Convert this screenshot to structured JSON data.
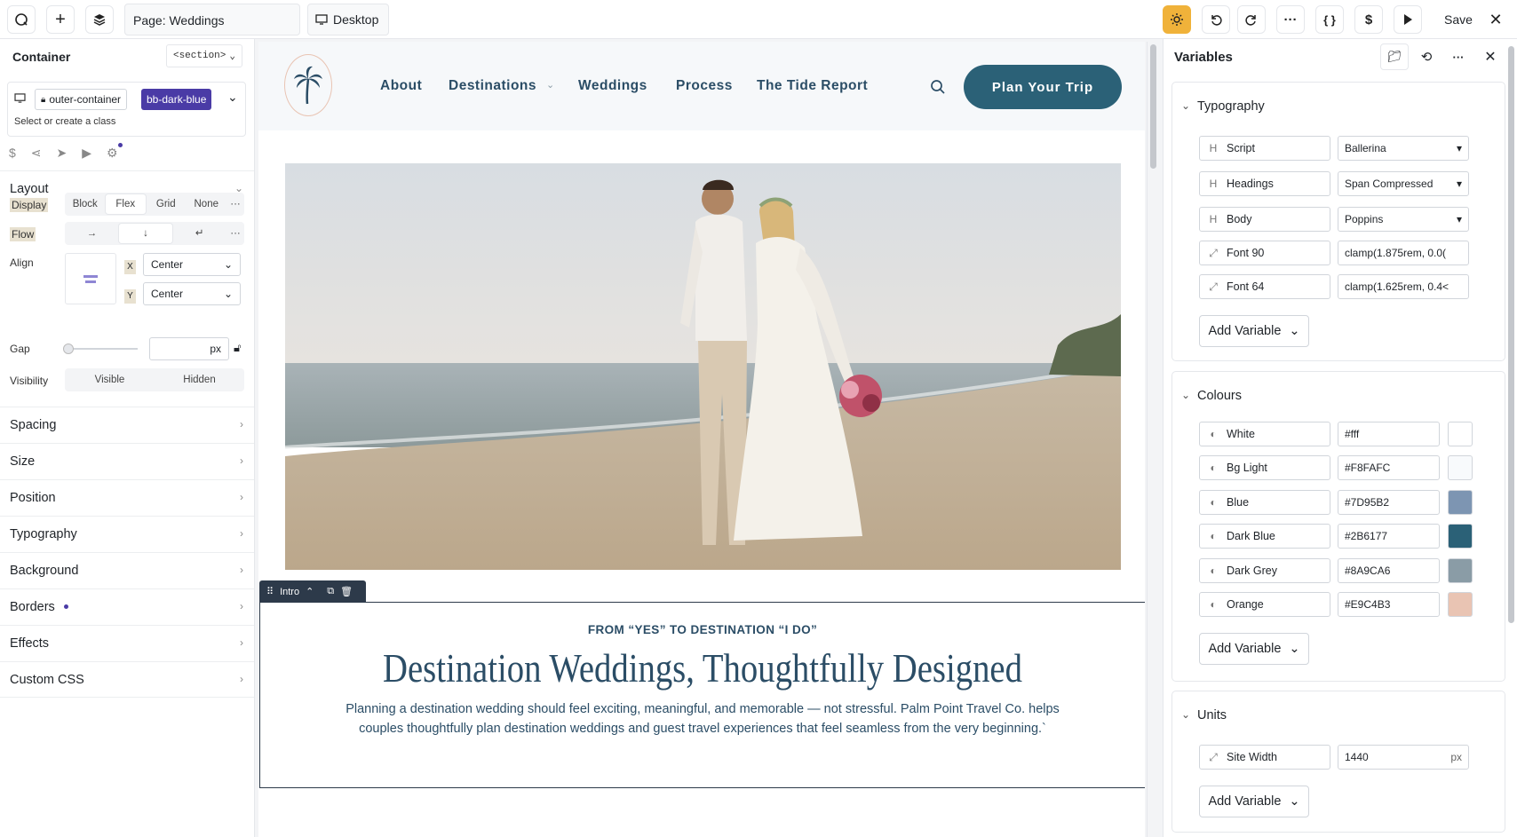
{
  "topbar": {
    "page_label": "Page: Weddings",
    "device_label": "Desktop",
    "save_label": "Save"
  },
  "left_panel": {
    "title": "Container",
    "tag": "<section>",
    "class_chip": "outer-container",
    "active_class": "bb-dark-blue",
    "class_hint": "Select or create a class",
    "layout": {
      "title": "Layout",
      "display_label": "Display",
      "display_options": [
        "Block",
        "Flex",
        "Grid",
        "None"
      ],
      "display_selected": "Flex",
      "flow_label": "Flow",
      "align_label": "Align",
      "x_label": "X",
      "x_value": "Center",
      "y_label": "Y",
      "y_value": "Center",
      "gap_label": "Gap",
      "gap_unit": "px",
      "visibility_label": "Visibility",
      "visibility_options": [
        "Visible",
        "Hidden"
      ]
    },
    "sections": [
      "Spacing",
      "Size",
      "Position",
      "Typography",
      "Background",
      "Borders",
      "Effects",
      "Custom CSS"
    ]
  },
  "canvas": {
    "nav_links": [
      "About",
      "Destinations",
      "Weddings",
      "Process",
      "The Tide Report"
    ],
    "cta_label": "Plan Your Trip",
    "intro_label": "Intro",
    "eyebrow": "FROM “YES” TO DESTINATION “I DO”",
    "headline": "Destination Weddings, Thoughtfully Designed",
    "body_line1": "Planning a destination wedding should feel exciting, meaningful, and memorable — not stressful. Palm Point Travel Co. helps",
    "body_line2": "couples thoughtfully plan destination weddings and guest travel experiences that feel seamless from the very beginning.`"
  },
  "right_panel": {
    "title": "Variables",
    "add_variable_label": "Add Variable",
    "typography": {
      "title": "Typography",
      "items": [
        {
          "name": "Script",
          "value": "Ballerina"
        },
        {
          "name": "Headings",
          "value": "Span Compressed"
        },
        {
          "name": "Body",
          "value": "Poppins"
        },
        {
          "name": "Font 90",
          "value": "clamp(1.875rem, 0.0("
        },
        {
          "name": "Font 64",
          "value": "clamp(1.625rem, 0.4<"
        }
      ]
    },
    "colours": {
      "title": "Colours",
      "items": [
        {
          "name": "White",
          "value": "#fff",
          "swatch": "#ffffff"
        },
        {
          "name": "Bg Light",
          "value": "#F8FAFC",
          "swatch": "#F8FAFC"
        },
        {
          "name": "Blue",
          "value": "#7D95B2",
          "swatch": "#7D95B2"
        },
        {
          "name": "Dark Blue",
          "value": "#2B6177",
          "swatch": "#2B6177"
        },
        {
          "name": "Dark Grey",
          "value": "#8A9CA6",
          "swatch": "#8A9CA6"
        },
        {
          "name": "Orange",
          "value": "#E9C4B3",
          "swatch": "#E9C4B3"
        }
      ]
    },
    "units": {
      "title": "Units",
      "items": [
        {
          "name": "Site Width",
          "value": "1440",
          "unit": "px"
        }
      ]
    }
  },
  "colors": {
    "accent": "#f0b23a",
    "class_chip": "#4a3ba6",
    "brand_dark_blue": "#2B6177",
    "brand_text": "#2b4d66"
  }
}
